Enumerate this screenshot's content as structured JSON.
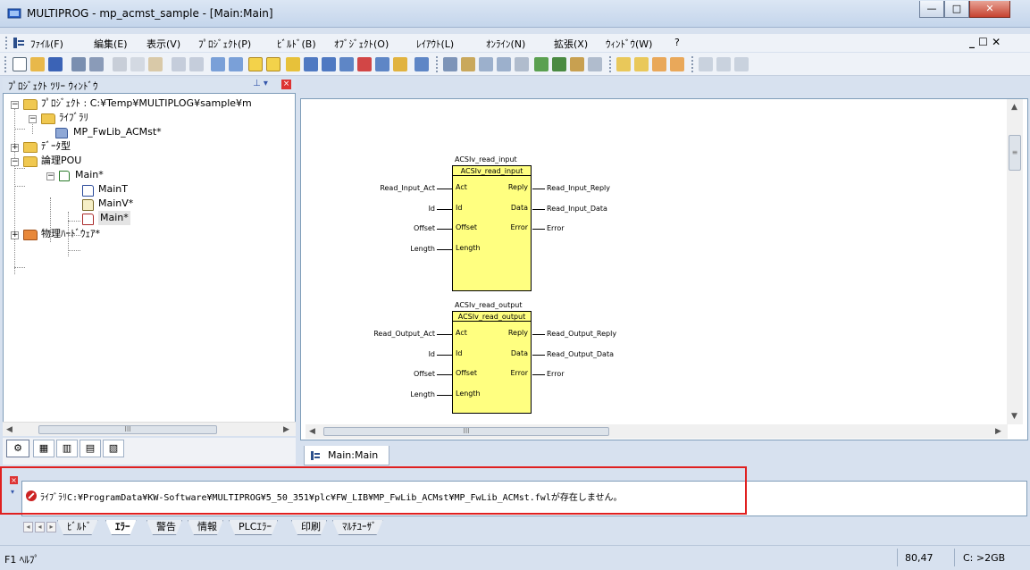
{
  "window": {
    "title": "MULTIPROG - mp_acmst_sample - [Main:Main]",
    "minimize": "—",
    "maximize": "□",
    "close": "✕",
    "mdi_restore": "_ ☐ ✕"
  },
  "menu": [
    {
      "label": "ﾌｧｲﾙ(F)"
    },
    {
      "label": "編集(E)"
    },
    {
      "label": "表示(V)"
    },
    {
      "label": "ﾌﾟﾛｼﾞｪｸﾄ(P)"
    },
    {
      "label": "ﾋﾞﾙﾄﾞ(B)"
    },
    {
      "label": "ｵﾌﾞｼﾞｪｸﾄ(O)"
    },
    {
      "label": "ﾚｲｱｳﾄ(L)"
    },
    {
      "label": "ｵﾝﾗｲﾝ(N)"
    },
    {
      "label": "拡張(X)"
    },
    {
      "label": "ｳｨﾝﾄﾞｳ(W)"
    },
    {
      "label": "?"
    }
  ],
  "tree_window": {
    "title": "ﾌﾟﾛｼﾞｪｸﾄ ﾂﾘｰ ｳｨﾝﾄﾞｳ",
    "nodes": {
      "project": "ﾌﾟﾛｼﾞｪｸﾄ : C:¥Temp¥MULTIPLOG¥sample¥m",
      "library": "ﾗｲﾌﾞﾗﾘ",
      "fwlib": "MP_FwLib_ACMst*",
      "datatype": "ﾃﾞｰﾀ型",
      "pou": "論理POU",
      "main": "Main*",
      "maint": "MainT",
      "mainv": "MainV*",
      "main_code": "Main*",
      "hardware": "物理ﾊｰﾄﾞｳｪｱ*"
    },
    "scroll_thumb": "III"
  },
  "editor": {
    "tab_label": "Main:Main",
    "hscroll_thumb": "III",
    "blocks": [
      {
        "instance": "ACSIv_read_input",
        "type": "ACSIv_read_input",
        "inputs": [
          {
            "pin": "Act",
            "var": "Read_Input_Act"
          },
          {
            "pin": "Id",
            "var": "Id"
          },
          {
            "pin": "Offset",
            "var": "Offset"
          },
          {
            "pin": "Length",
            "var": "Length"
          }
        ],
        "outputs": [
          {
            "pin": "Reply",
            "var": "Read_Input_Reply"
          },
          {
            "pin": "Data",
            "var": "Read_Input_Data"
          },
          {
            "pin": "Error",
            "var": "Error"
          }
        ]
      },
      {
        "instance": "ACSIv_read_output",
        "type": "ACSIv_read_output",
        "inputs": [
          {
            "pin": "Act",
            "var": "Read_Output_Act"
          },
          {
            "pin": "Id",
            "var": "Id"
          },
          {
            "pin": "Offset",
            "var": "Offset"
          },
          {
            "pin": "Length",
            "var": "Length"
          }
        ],
        "outputs": [
          {
            "pin": "Reply",
            "var": "Read_Output_Reply"
          },
          {
            "pin": "Data",
            "var": "Read_Output_Data"
          },
          {
            "pin": "Error",
            "var": "Error"
          }
        ]
      }
    ]
  },
  "output": {
    "message": "ﾗｲﾌﾞﾗﾘC:¥ProgramData¥KW-Software¥MULTIPROG¥5_50_351¥plc¥FW_LIB¥MP_FwLib_ACMst¥MP_FwLib_ACMst.fwlが存在しません。",
    "tabs": [
      {
        "label": "ﾋﾞﾙﾄﾞ"
      },
      {
        "label": "ｴﾗｰ"
      },
      {
        "label": "警告"
      },
      {
        "label": "情報"
      },
      {
        "label": "PLCｴﾗｰ"
      },
      {
        "label": "印刷"
      },
      {
        "label": "ﾏﾙﾁﾕｰｻﾞ"
      }
    ]
  },
  "status": {
    "help": "F1 ﾍﾙﾌﾟ",
    "position": "80,47",
    "memory": "C: >2GB"
  },
  "colors": {
    "block_fill": "#ffff80",
    "error_highlight": "#e02020",
    "background": "#d7e1ef"
  }
}
